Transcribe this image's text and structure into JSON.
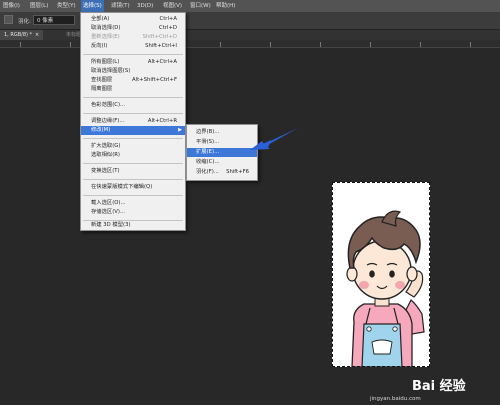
{
  "menubar": {
    "items": [
      {
        "label": "图像(I)"
      },
      {
        "label": "图层(L)"
      },
      {
        "label": "类型(Y)"
      },
      {
        "label": "选择(S)"
      },
      {
        "label": "滤镜(T)"
      },
      {
        "label": "3D(D)"
      },
      {
        "label": "视图(V)"
      },
      {
        "label": "窗口(W)"
      },
      {
        "label": "帮助(H)"
      }
    ],
    "active_index": 3
  },
  "options_bar": {
    "feather_label": "羽化:",
    "feather_value": "0 像素",
    "check_glyph": "✔"
  },
  "document_tabs": {
    "active_tab": "1, RGB/8) *",
    "active_close": "×",
    "inactive_tab": "未标题-2 @ 1..."
  },
  "select_menu": {
    "items": [
      {
        "label": "全部(A)",
        "shortcut": "Ctrl+A",
        "disabled": false
      },
      {
        "label": "取消选择(D)",
        "shortcut": "Ctrl+D",
        "disabled": false
      },
      {
        "label": "重新选择(E)",
        "shortcut": "Shift+Ctrl+D",
        "disabled": true
      },
      {
        "label": "反向(I)",
        "shortcut": "Shift+Ctrl+I",
        "disabled": false
      },
      {
        "label": "所有图层(L)",
        "shortcut": "Alt+Ctrl+A",
        "disabled": false
      },
      {
        "label": "取消选择图层(S)",
        "shortcut": "",
        "disabled": false
      },
      {
        "label": "查找图层",
        "shortcut": "Alt+Shift+Ctrl+F",
        "disabled": false
      },
      {
        "label": "隔离图层",
        "shortcut": "",
        "disabled": false
      },
      {
        "label": "色彩范围(C)...",
        "shortcut": "",
        "disabled": false
      },
      {
        "label": "调整边缘(F)...",
        "shortcut": "Alt+Ctrl+R",
        "disabled": false
      },
      {
        "label": "修改(M)",
        "shortcut": "",
        "disabled": false,
        "submenu_arrow": "▶"
      },
      {
        "label": "扩大选取(G)",
        "shortcut": "",
        "disabled": false
      },
      {
        "label": "选取相似(R)",
        "shortcut": "",
        "disabled": false
      },
      {
        "label": "变换选区(T)",
        "shortcut": "",
        "disabled": false
      },
      {
        "label": "在快速蒙版模式下编辑(Q)",
        "shortcut": "",
        "disabled": false
      },
      {
        "label": "载入选区(O)...",
        "shortcut": "",
        "disabled": false
      },
      {
        "label": "存储选区(V)...",
        "shortcut": "",
        "disabled": false
      },
      {
        "label": "新建 3D 模型(3)",
        "shortcut": "",
        "disabled": false
      }
    ],
    "highlighted_index": 10
  },
  "modify_submenu": {
    "items": [
      {
        "label": "边界(B)...",
        "shortcut": ""
      },
      {
        "label": "平滑(S)...",
        "shortcut": ""
      },
      {
        "label": "扩展(E)...",
        "shortcut": ""
      },
      {
        "label": "收缩(C)...",
        "shortcut": ""
      },
      {
        "label": "羽化(F)...",
        "shortcut": "Shift+F6"
      }
    ],
    "highlighted_index": 2
  },
  "watermark": {
    "logo_text": "Bai 经验",
    "url": "jingyan.baidu.com"
  },
  "colors": {
    "menu_highlight": "#3d78d8",
    "annotation_arrow": "#2a5fd6",
    "background": "#282828"
  }
}
